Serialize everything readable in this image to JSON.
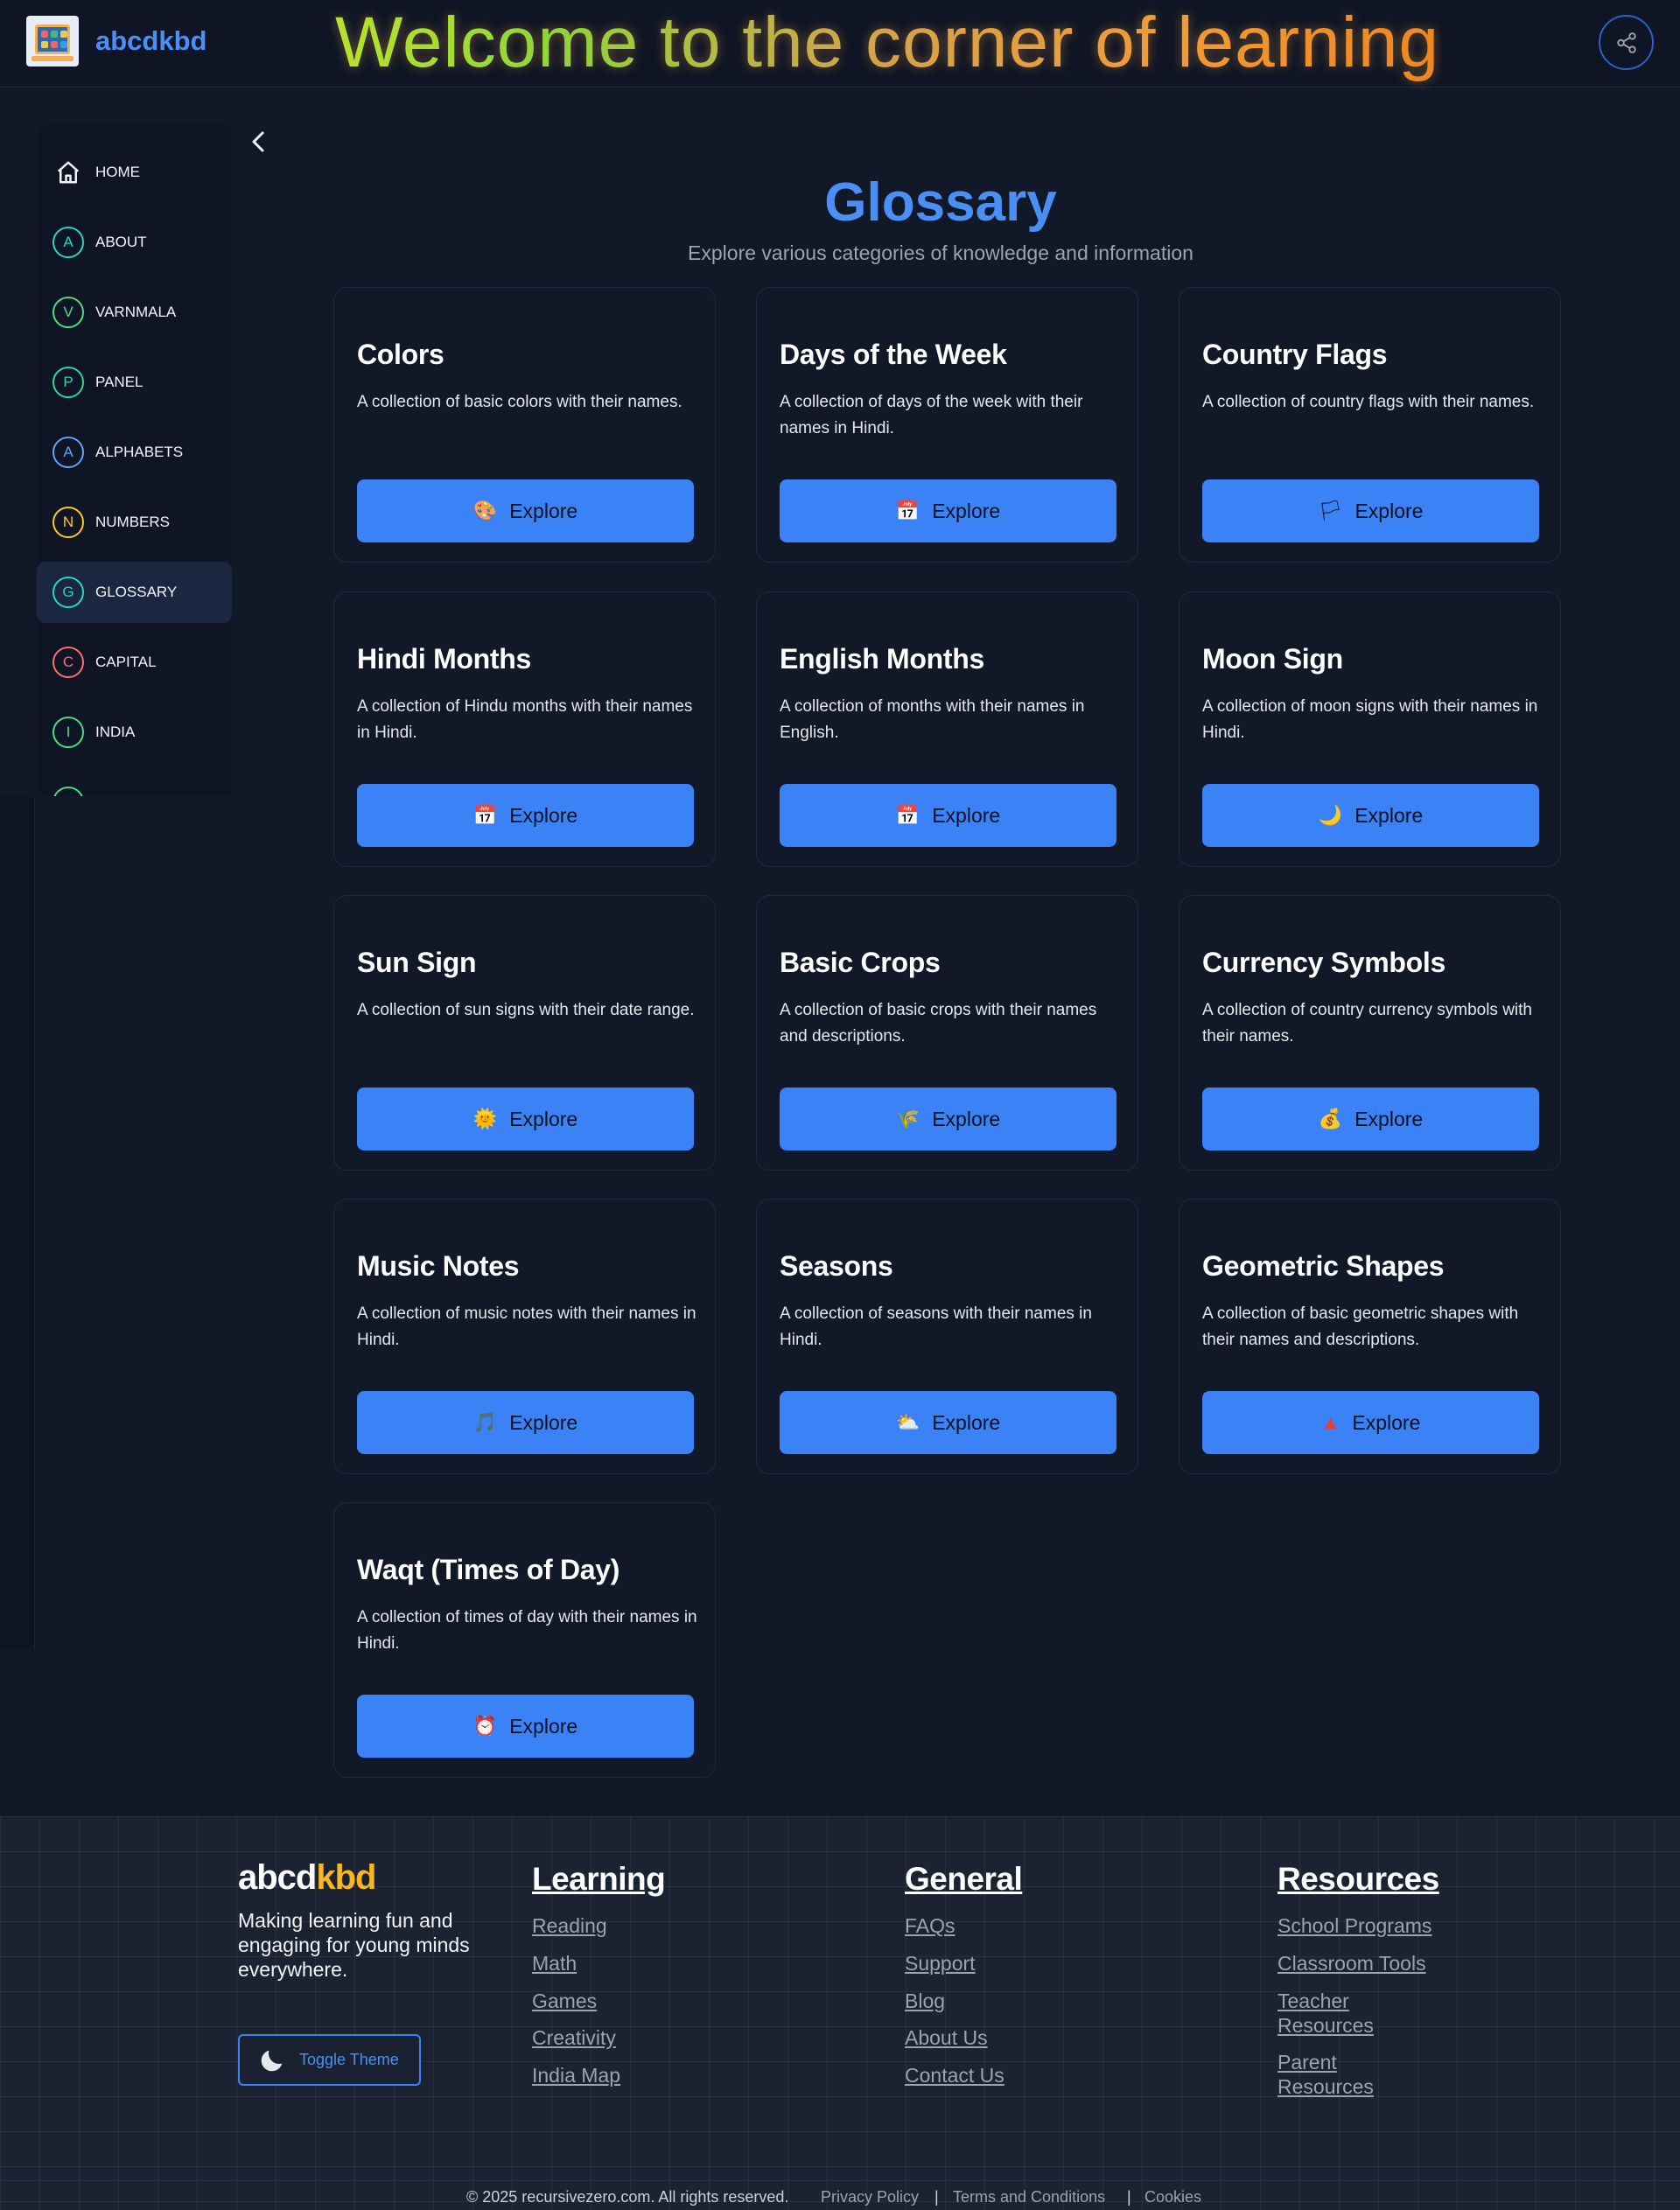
{
  "header": {
    "brand": "abcdkbd",
    "welcome": "Welcome to the corner of learning"
  },
  "sidebar": {
    "items": [
      {
        "label": "HOME",
        "badge": "",
        "color": "#e5e7eb"
      },
      {
        "label": "ABOUT",
        "badge": "A",
        "color": "#2dd4bf"
      },
      {
        "label": "VARNMALA",
        "badge": "V",
        "color": "#4ade80"
      },
      {
        "label": "PANEL",
        "badge": "P",
        "color": "#34d399"
      },
      {
        "label": "ALPHABETS",
        "badge": "A",
        "color": "#60a5fa"
      },
      {
        "label": "NUMBERS",
        "badge": "N",
        "color": "#facc15"
      },
      {
        "label": "GLOSSARY",
        "badge": "G",
        "color": "#2dd4bf"
      },
      {
        "label": "CAPITAL",
        "badge": "C",
        "color": "#f87171"
      },
      {
        "label": "INDIA",
        "badge": "I",
        "color": "#4ade80"
      }
    ]
  },
  "main": {
    "title": "Glossary",
    "subtitle": "Explore various categories of knowledge and information",
    "cards": [
      {
        "title": "Colors",
        "desc": "A collection of basic colors with their names.",
        "button": "Explore",
        "icon": "palette-icon"
      },
      {
        "title": "Days of the Week",
        "desc": "A collection of days of the week with their names in Hindi.",
        "button": "Explore",
        "icon": "calendar-icon"
      },
      {
        "title": "Country Flags",
        "desc": "A collection of country flags with their names.",
        "button": "Explore",
        "icon": "flag-icon"
      },
      {
        "title": "Hindi Months",
        "desc": "A collection of Hindu months with their names in Hindi.",
        "button": "Explore",
        "icon": "calendar-icon"
      },
      {
        "title": "English Months",
        "desc": "A collection of months with their names in English.",
        "button": "Explore",
        "icon": "calendar-icon"
      },
      {
        "title": "Moon Sign",
        "desc": "A collection of moon signs with their names in Hindi.",
        "button": "Explore",
        "icon": "moon-icon"
      },
      {
        "title": "Sun Sign",
        "desc": "A collection of sun signs with their date range.",
        "button": "Explore",
        "icon": "sun-icon"
      },
      {
        "title": "Basic Crops",
        "desc": "A collection of basic crops with their names and descriptions.",
        "button": "Explore",
        "icon": "crop-icon"
      },
      {
        "title": "Currency Symbols",
        "desc": "A collection of country currency symbols with their names.",
        "button": "Explore",
        "icon": "money-bag-icon"
      },
      {
        "title": "Music Notes",
        "desc": "A collection of music notes with their names in Hindi.",
        "button": "Explore",
        "icon": "music-note-icon"
      },
      {
        "title": "Seasons",
        "desc": "A collection of seasons with their names in Hindi.",
        "button": "Explore",
        "icon": "cloud-icon"
      },
      {
        "title": "Geometric Shapes",
        "desc": "A collection of basic geometric shapes with their names and descriptions.",
        "button": "Explore",
        "icon": "triangle-icon"
      },
      {
        "title": "Waqt (Times of Day)",
        "desc": "A collection of times of day with their names in Hindi.",
        "button": "Explore",
        "icon": "alarm-clock-icon"
      }
    ]
  },
  "footer": {
    "brand_a": "abcd",
    "brand_b": "kbd",
    "tagline": "Making learning fun and engaging for young minds everywhere.",
    "theme_button": "Toggle Theme",
    "columns": [
      {
        "heading": "Learning",
        "links": [
          "Reading",
          "Math",
          "Games",
          "Creativity",
          "India Map"
        ]
      },
      {
        "heading": "General",
        "links": [
          "FAQs",
          "Support",
          "Blog",
          "About Us",
          "Contact Us"
        ]
      },
      {
        "heading": "Resources",
        "links": [
          "School Programs",
          "Classroom Tools",
          "Teacher Resources",
          "Parent Resources"
        ]
      }
    ],
    "copyright": "© 2025 recursivezero.com. All rights reserved.",
    "legal_links": [
      "Privacy Policy",
      "Terms and Conditions",
      "Cookies"
    ],
    "separator": "|"
  }
}
